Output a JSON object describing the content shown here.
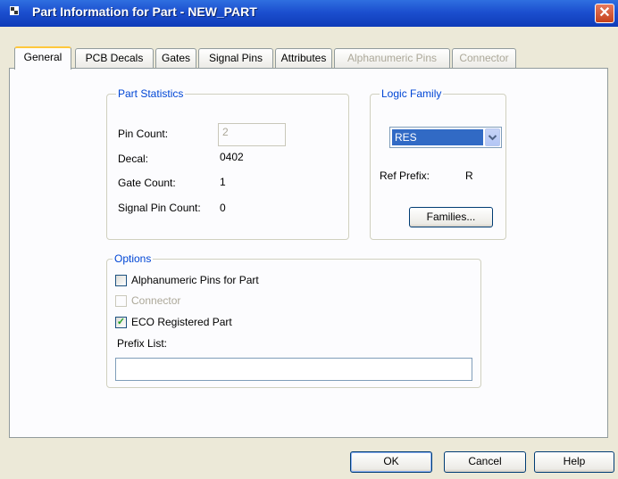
{
  "window": {
    "title": "Part Information for Part - NEW_PART",
    "close_symbol": "✕"
  },
  "tabs": [
    {
      "label": "General",
      "active": true,
      "enabled": true
    },
    {
      "label": "PCB Decals",
      "active": false,
      "enabled": true
    },
    {
      "label": "Gates",
      "active": false,
      "enabled": true
    },
    {
      "label": "Signal Pins",
      "active": false,
      "enabled": true
    },
    {
      "label": "Attributes",
      "active": false,
      "enabled": true
    },
    {
      "label": "Alphanumeric Pins",
      "active": false,
      "enabled": false
    },
    {
      "label": "Connector",
      "active": false,
      "enabled": false
    }
  ],
  "part_statistics": {
    "title": "Part Statistics",
    "pin_count_label": "Pin Count:",
    "pin_count_value": "2",
    "decal_label": "Decal:",
    "decal_value": "0402",
    "gate_count_label": "Gate Count:",
    "gate_count_value": "1",
    "signal_pin_count_label": "Signal Pin Count:",
    "signal_pin_count_value": "0"
  },
  "logic_family": {
    "title": "Logic Family",
    "selected": "RES",
    "ref_prefix_label": "Ref Prefix:",
    "ref_prefix_value": "R",
    "families_button": "Families..."
  },
  "options": {
    "title": "Options",
    "alphanumeric_pins_label": "Alphanumeric Pins for Part",
    "alphanumeric_pins_checked": false,
    "connector_label": "Connector",
    "connector_checked": false,
    "eco_registered_label": "ECO Registered Part",
    "eco_registered_checked": true,
    "prefix_list_label": "Prefix List:",
    "prefix_list_value": ""
  },
  "buttons": {
    "ok": "OK",
    "cancel": "Cancel",
    "help": "Help"
  },
  "colors": {
    "title_bar": "#1c4fcf",
    "group_title": "#0046d5",
    "selection": "#316ac5",
    "dialog_bg": "#ece9d8"
  }
}
